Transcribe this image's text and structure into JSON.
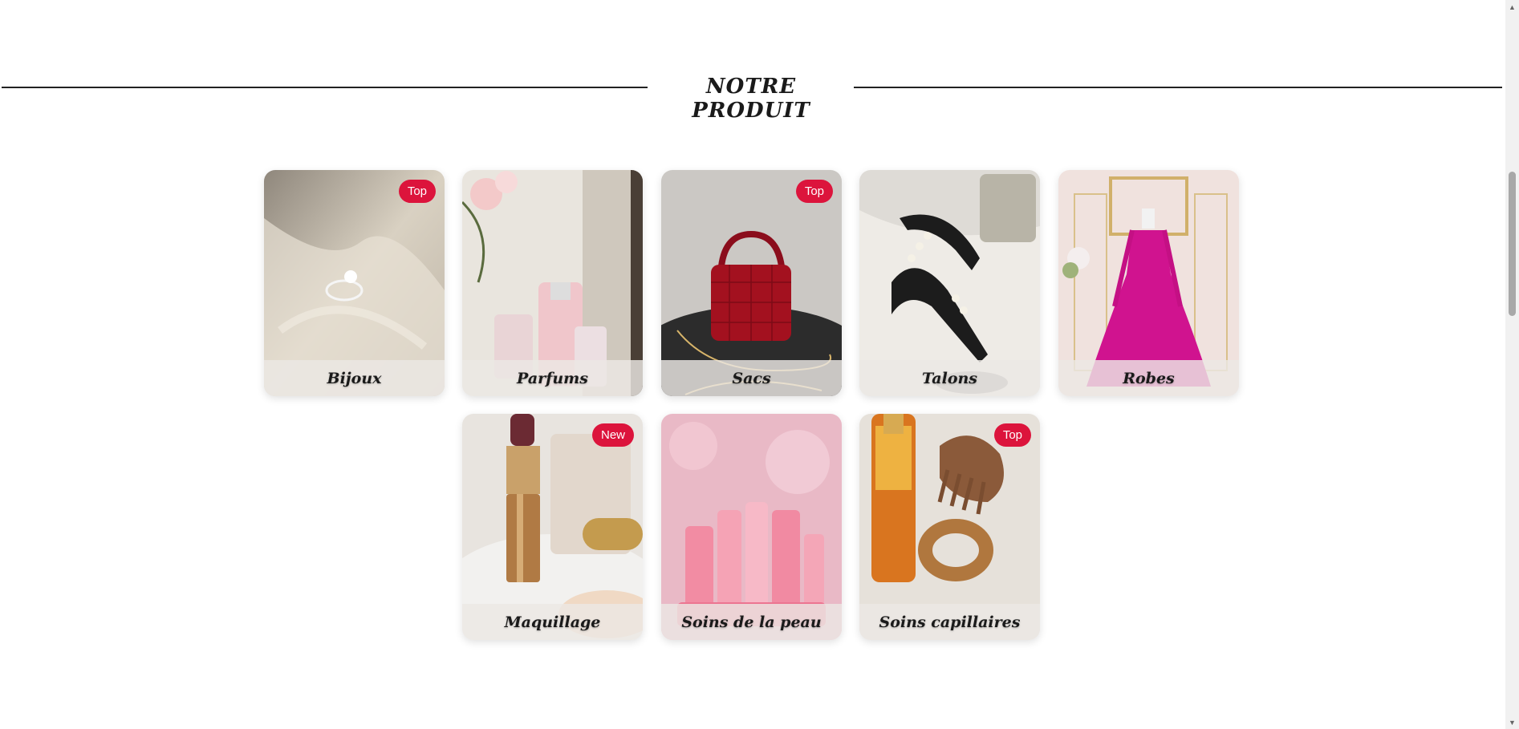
{
  "section": {
    "title": "NOTRE PRODUIT"
  },
  "products": [
    {
      "name": "Bijoux",
      "badge": "Top"
    },
    {
      "name": "Parfums",
      "badge": ""
    },
    {
      "name": "Sacs",
      "badge": "Top"
    },
    {
      "name": "Talons",
      "badge": ""
    },
    {
      "name": "Robes",
      "badge": ""
    },
    {
      "name": "Maquillage",
      "badge": "New"
    },
    {
      "name": "Soins de la peau",
      "badge": ""
    },
    {
      "name": "Soins capillaires",
      "badge": "Top"
    }
  ],
  "colors": {
    "badge": "#dc143c",
    "rule": "#222222",
    "page": "#ffffff"
  },
  "icons": {
    "scroll_up": "triangle-up-icon",
    "scroll_down": "triangle-down-icon"
  }
}
